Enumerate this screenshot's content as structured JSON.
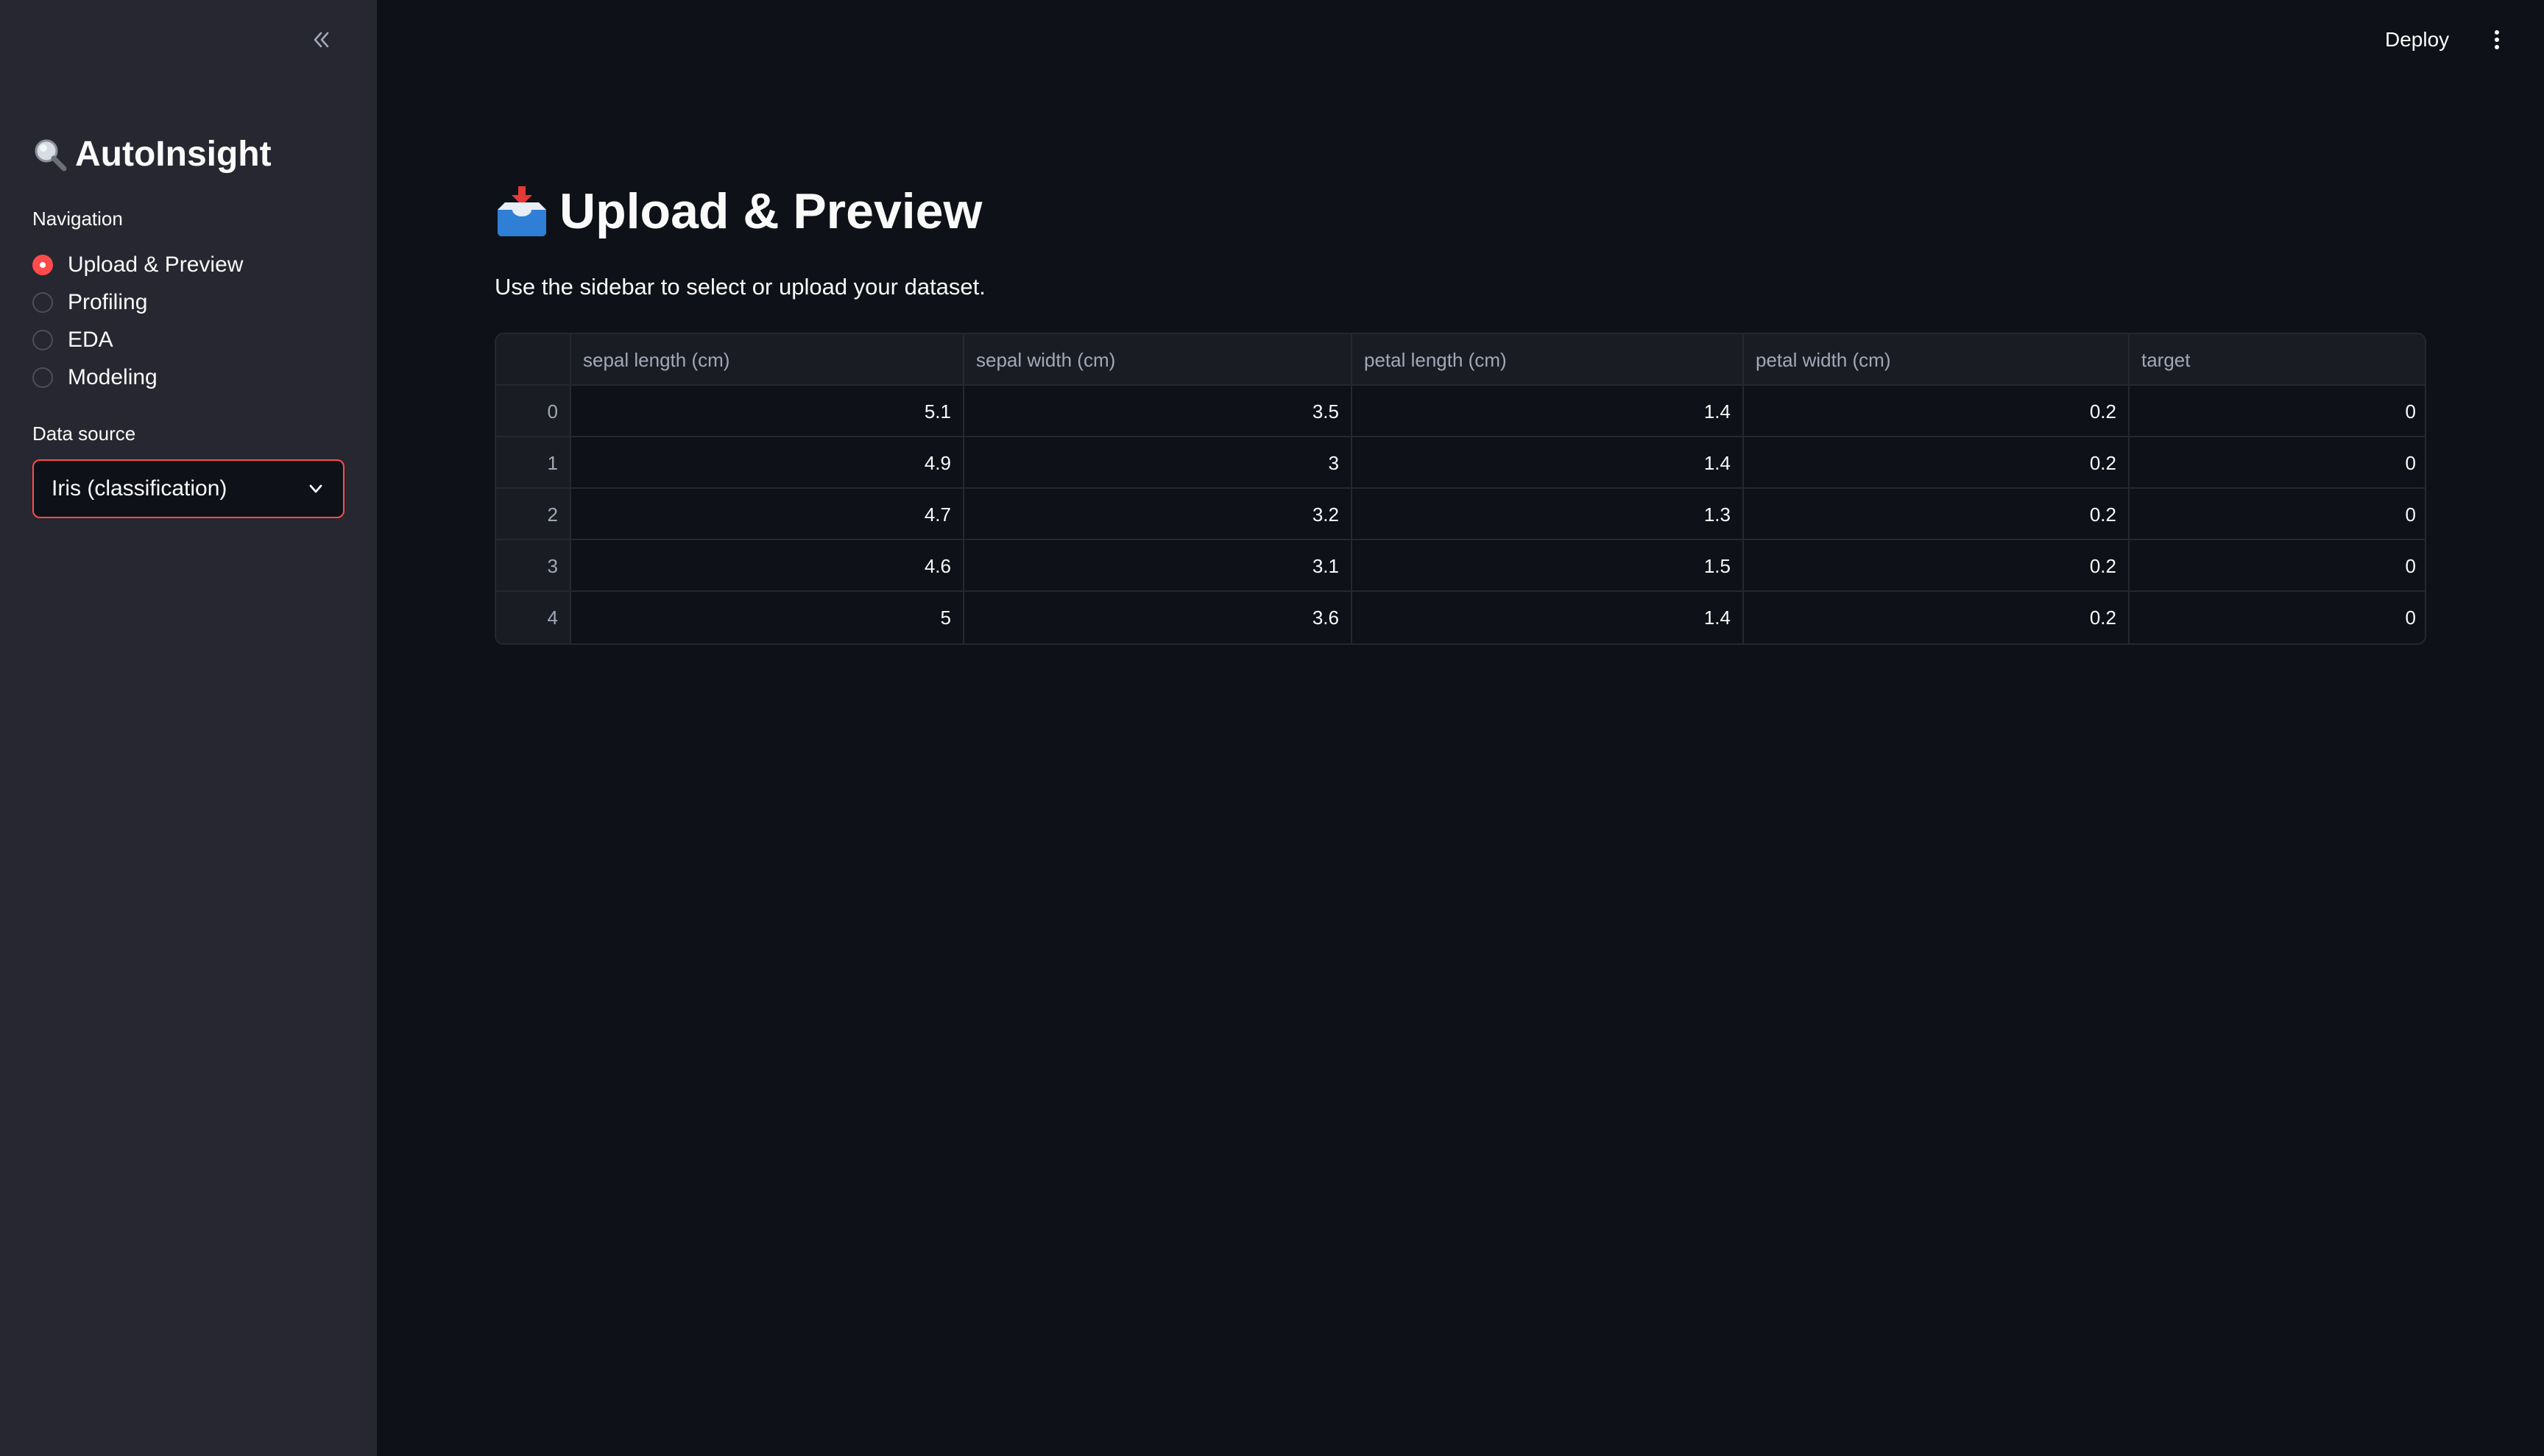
{
  "app": {
    "title": "AutoInsight"
  },
  "sidebar": {
    "nav_label": "Navigation",
    "items": [
      {
        "label": "Upload & Preview",
        "selected": true
      },
      {
        "label": "Profiling",
        "selected": false
      },
      {
        "label": "EDA",
        "selected": false
      },
      {
        "label": "Modeling",
        "selected": false
      }
    ],
    "data_source_label": "Data source",
    "data_source_value": "Iris (classification)"
  },
  "header": {
    "deploy_label": "Deploy"
  },
  "main": {
    "title": "Upload & Preview",
    "subtitle": "Use the sidebar to select or upload your dataset.",
    "table": {
      "columns": [
        "",
        "sepal length (cm)",
        "sepal width (cm)",
        "petal length (cm)",
        "petal width (cm)",
        "target"
      ],
      "rows": [
        [
          "0",
          "5.1",
          "3.5",
          "1.4",
          "0.2",
          "0"
        ],
        [
          "1",
          "4.9",
          "3",
          "1.4",
          "0.2",
          "0"
        ],
        [
          "2",
          "4.7",
          "3.2",
          "1.3",
          "0.2",
          "0"
        ],
        [
          "3",
          "4.6",
          "3.1",
          "1.5",
          "0.2",
          "0"
        ],
        [
          "4",
          "5",
          "3.6",
          "1.4",
          "0.2",
          "0"
        ]
      ]
    }
  },
  "icons": {
    "collapse": "double-chevron-left-icon",
    "brand": "magnifying-glass-icon",
    "title": "inbox-tray-icon",
    "select": "chevron-down-icon",
    "menu": "kebab-menu-icon"
  },
  "colors": {
    "accent": "#ff4b4b",
    "background": "#0e1117",
    "sidebar": "#262730",
    "text": "#fafafa"
  }
}
